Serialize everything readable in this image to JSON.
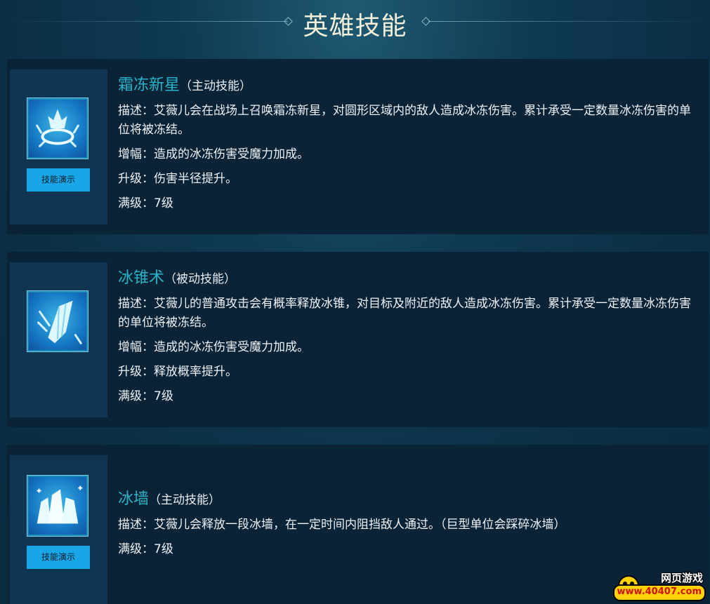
{
  "header": {
    "title": "英雄技能"
  },
  "skills": [
    {
      "name": "霜冻新星",
      "type": "（主动技能）",
      "icon": "frost-nova-icon",
      "demo_label": "技能演示",
      "lines": [
        "描述：艾薇儿会在战场上召唤霜冻新星，对圆形区域内的敌人造成冰冻伤害。累计承受一定数量冰冻伤害的单位将被冻结。",
        "增幅：造成的冰冻伤害受魔力加成。",
        "升级：伤害半径提升。",
        "满级：7级"
      ]
    },
    {
      "name": "冰锥术",
      "type": "（被动技能）",
      "icon": "ice-shard-icon",
      "lines": [
        "描述：艾薇儿的普通攻击会有概率释放冰锥，对目标及附近的敌人造成冰冻伤害。累计承受一定数量冰冻伤害的单位将被冻结。",
        "增幅：造成的冰冻伤害受魔力加成。",
        "升级：释放概率提升。",
        "满级：7级"
      ]
    },
    {
      "name": "冰墙",
      "type": "（主动技能）",
      "icon": "ice-wall-icon",
      "demo_label": "技能演示",
      "lines": [
        "描述：艾薇儿会释放一段冰墙，在一定时间内阻挡敌人通过。（巨型单位会踩碎冰墙）",
        "满级：7级"
      ]
    }
  ],
  "watermark": {
    "top": "网页游戏",
    "bottom": "www.40407.com"
  },
  "colors": {
    "accent_title": "#27b4c6",
    "demo_button": "#18a6e6",
    "card_bg": "#0b2337",
    "icon_panel_bg": "#0f3553"
  }
}
